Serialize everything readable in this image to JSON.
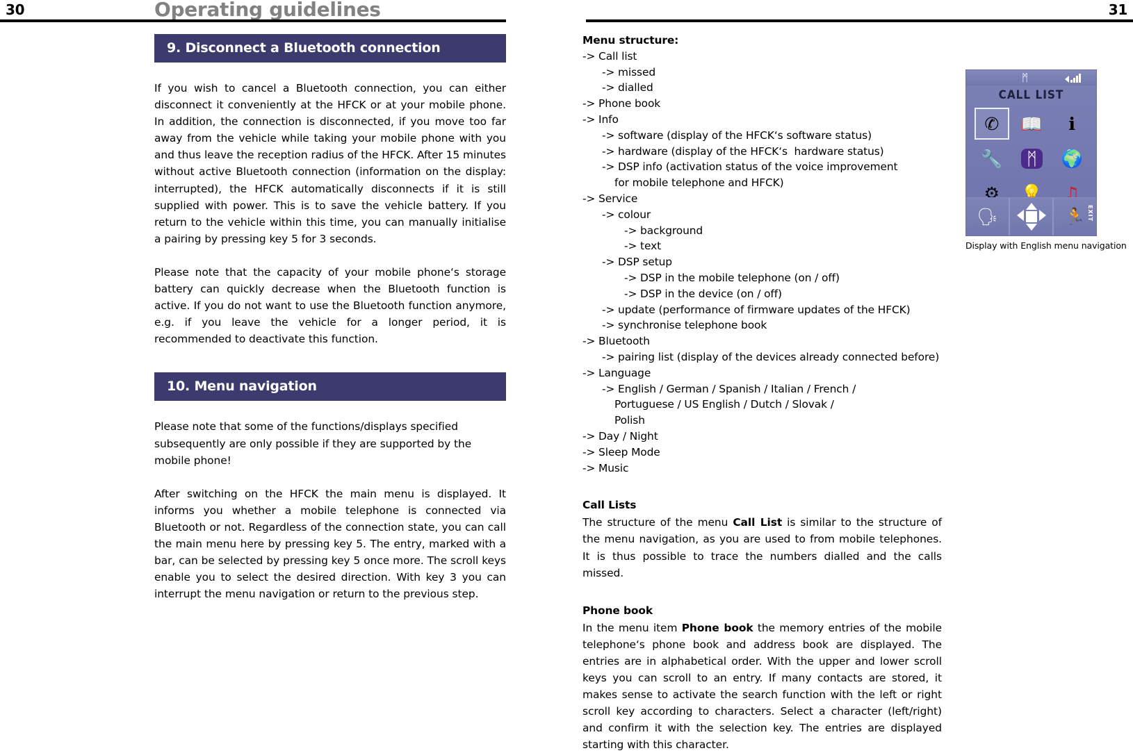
{
  "header": {
    "page_left": "30",
    "page_right": "31",
    "title": "Operating guidelines"
  },
  "colors": {
    "section_bar": "#3d3b6e",
    "title_gray": "#828282",
    "display_bg": "#767cb2"
  },
  "left_column": {
    "section9": {
      "heading": "9. Disconnect a Bluetooth connection",
      "paragraphs": [
        "If you wish to cancel a Bluetooth connection, you can either disconnect it conveniently at the HFCK or at your mobile phone. In addition, the connection is disconnected, if you move too far away from the vehicle while taking your mobile phone with you and thus leave the reception radius of the HFCK. After 15 minutes without active Bluetooth connection (information on the display: interrupted), the HFCK automatically disconnects if it is still supplied with power. This is to save the vehicle battery. If you return to the vehicle within this time, you can manually initialise a pairing by pressing key 5 for 3 seconds.",
        "Please note that the capacity of your mobile phone‘s storage battery can quickly decrease when the Bluetooth function is active. If you do not want to use the Bluetooth function anymore, e.g. if you leave the vehicle for a longer period, it is recommended to deactivate this function."
      ]
    },
    "section10": {
      "heading": "10. Menu navigation",
      "paragraphs": [
        "Please note that some of the functions/displays specified subsequently are only possible if they are supported by the mobile phone!",
        "After switching on the HFCK the main menu is displayed. It informs you whether a mobile telephone is connected via Bluetooth or not. Regardless of the connection state, you can call the main menu here by pressing key 5. The entry, marked with a bar, can be selected by pressing key 5 once more. The scroll keys enable you to select the desired direction. With key 3 you can interrupt the menu navigation or return to the previous step."
      ]
    }
  },
  "right_column": {
    "menu_structure_title": "Menu structure:",
    "menu_tree": [
      {
        "level": 0,
        "text": "-> Call list"
      },
      {
        "level": 1,
        "text": "-> missed"
      },
      {
        "level": 1,
        "text": "-> dialled"
      },
      {
        "level": 0,
        "text": "-> Phone book"
      },
      {
        "level": 0,
        "text": "-> Info"
      },
      {
        "level": 1,
        "text": "-> software (display of the HFCK‘s software status)"
      },
      {
        "level": 1,
        "text": "-> hardware (display of the HFCK‘s  hardware status)"
      },
      {
        "level": 1,
        "text": "-> DSP info (activation status of the voice improvement"
      },
      {
        "level": 3,
        "text": "for mobile telephone and HFCK)"
      },
      {
        "level": 0,
        "text": "-> Service"
      },
      {
        "level": 1,
        "text": "-> colour"
      },
      {
        "level": 2,
        "text": "-> background"
      },
      {
        "level": 2,
        "text": "-> text"
      },
      {
        "level": 1,
        "text": "-> DSP setup"
      },
      {
        "level": 2,
        "text": "-> DSP in the mobile telephone (on / off)"
      },
      {
        "level": 2,
        "text": "-> DSP in the device (on / off)"
      },
      {
        "level": 1,
        "text": "-> update (performance of firmware updates of the HFCK)"
      },
      {
        "level": 1,
        "text": "-> synchronise telephone book"
      },
      {
        "level": 0,
        "text": "-> Bluetooth"
      },
      {
        "level": 1,
        "text": "-> pairing list (display of the devices already connected before)"
      },
      {
        "level": 0,
        "text": "-> Language"
      },
      {
        "level": 1,
        "text": "-> English / German / Spanish / Italian / French /"
      },
      {
        "level": 3,
        "text": "Portuguese / US English / Dutch / Slovak /"
      },
      {
        "level": 3,
        "text": "Polish"
      },
      {
        "level": 0,
        "text": "-> Day / Night"
      },
      {
        "level": 0,
        "text": "-> Sleep Mode"
      },
      {
        "level": 0,
        "text": "-> Music"
      }
    ],
    "call_lists": {
      "heading": "Call Lists",
      "body_before": "The structure of the menu ",
      "body_bold": "Call List",
      "body_after": " is similar to the structure of the menu navigation, as you are used to from mobile telephones. It is thus possible to trace the numbers dialled and the calls missed."
    },
    "phone_book": {
      "heading": "Phone book",
      "body_before": "In the menu item ",
      "body_bold": "Phone book",
      "body_after": " the memory entries of the mobile telephone‘s phone book and address book are displayed. The entries are in alphabetical order. With the upper and lower scroll keys you can scroll to an entry. If many contacts are stored, it makes sense to activate the search function with the left or right scroll key according to characters. Select a character (left/right) and confirm it with the selection key. The entries are displayed starting with this character."
    }
  },
  "figure": {
    "caption": "Display with English menu navigation",
    "display": {
      "title": "CALL LIST",
      "status_icons": [
        "bluetooth-icon",
        "speaker-icon",
        "signal-bars-icon"
      ],
      "menu_icons": [
        {
          "name": "call-list-icon",
          "glyph": "✆",
          "selected": true
        },
        {
          "name": "phone-book-icon",
          "glyph": "📖",
          "selected": false
        },
        {
          "name": "info-icon",
          "glyph": "ℹ",
          "selected": false
        },
        {
          "name": "service-wrench-icon",
          "glyph": "🔧",
          "selected": false
        },
        {
          "name": "bluetooth-icon",
          "glyph": "ᛗ",
          "selected": false
        },
        {
          "name": "language-globe-icon",
          "glyph": "🌍",
          "selected": false
        },
        {
          "name": "settings-gears-icon",
          "glyph": "⚙",
          "selected": false
        },
        {
          "name": "day-night-bulb-icon",
          "glyph": "💡",
          "selected": false
        },
        {
          "name": "music-note-icon",
          "glyph": "♫",
          "selected": false
        }
      ],
      "soft_keys": [
        {
          "name": "voice-dial-icon",
          "glyph": "🗣"
        },
        {
          "name": "dpad-icon",
          "glyph": ""
        },
        {
          "name": "exit-icon",
          "glyph": "🏃",
          "label": "EXIT"
        }
      ]
    }
  }
}
